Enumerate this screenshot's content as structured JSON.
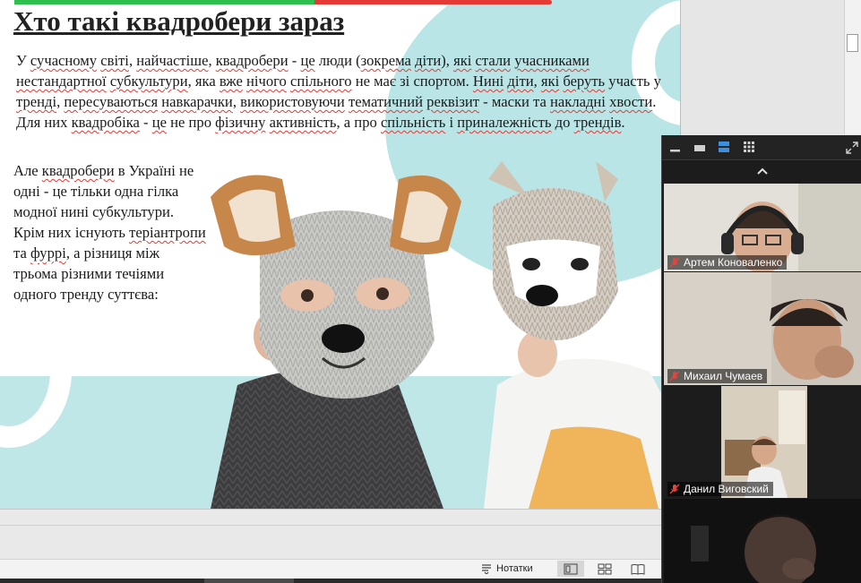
{
  "slide": {
    "title": "Хто такі квадробери зараз",
    "para1": [
      {
        "t": "У ",
        "s": false
      },
      {
        "t": "сучасному",
        "s": true
      },
      {
        "t": " ",
        "s": false
      },
      {
        "t": "світі",
        "s": true
      },
      {
        "t": ", ",
        "s": false
      },
      {
        "t": "найчастіше",
        "s": true
      },
      {
        "t": ", ",
        "s": false
      },
      {
        "t": "квадробери",
        "s": true
      },
      {
        "t": " - ",
        "s": false
      },
      {
        "t": "це",
        "s": true
      },
      {
        "t": " люди (",
        "s": false
      },
      {
        "t": "зокрема",
        "s": true
      },
      {
        "t": " ",
        "s": false
      },
      {
        "t": "діти",
        "s": true
      },
      {
        "t": "), ",
        "s": false
      },
      {
        "t": "які",
        "s": true
      },
      {
        "t": " ",
        "s": false
      },
      {
        "t": "стали",
        "s": true
      },
      {
        "t": " ",
        "s": false
      },
      {
        "t": "учасниками",
        "s": true
      },
      {
        "t": " ",
        "s": false
      },
      {
        "t": "нестандартної",
        "s": true
      },
      {
        "t": " ",
        "s": false
      },
      {
        "t": "субкультури",
        "s": true
      },
      {
        "t": ", яка ",
        "s": false
      },
      {
        "t": "вже",
        "s": true
      },
      {
        "t": " ",
        "s": false
      },
      {
        "t": "нічого",
        "s": true
      },
      {
        "t": " ",
        "s": false
      },
      {
        "t": "спільного",
        "s": true
      },
      {
        "t": " не має зі спортом. ",
        "s": false
      },
      {
        "t": "Нині",
        "s": true
      },
      {
        "t": " ",
        "s": false
      },
      {
        "t": "діти",
        "s": true
      },
      {
        "t": ", ",
        "s": false
      },
      {
        "t": "які",
        "s": true
      },
      {
        "t": " ",
        "s": false
      },
      {
        "t": "беруть",
        "s": true
      },
      {
        "t": " участь у ",
        "s": false
      },
      {
        "t": "тренді",
        "s": true
      },
      {
        "t": ", ",
        "s": false
      },
      {
        "t": "пересуваються",
        "s": true
      },
      {
        "t": " ",
        "s": false
      },
      {
        "t": "навкарачки",
        "s": true
      },
      {
        "t": ", ",
        "s": false
      },
      {
        "t": "використовуючи",
        "s": true
      },
      {
        "t": " ",
        "s": false
      },
      {
        "t": "тематичний",
        "s": true
      },
      {
        "t": " ",
        "s": false
      },
      {
        "t": "реквізит",
        "s": true
      },
      {
        "t": " - маски та ",
        "s": false
      },
      {
        "t": "накладні",
        "s": true
      },
      {
        "t": " ",
        "s": false
      },
      {
        "t": "хвости",
        "s": true
      },
      {
        "t": ". Для них ",
        "s": false
      },
      {
        "t": "квадробіка",
        "s": true
      },
      {
        "t": " - ",
        "s": false
      },
      {
        "t": "це",
        "s": true
      },
      {
        "t": " не про ",
        "s": false
      },
      {
        "t": "фізичну",
        "s": true
      },
      {
        "t": " ",
        "s": false
      },
      {
        "t": "активність",
        "s": true
      },
      {
        "t": ", а про ",
        "s": false
      },
      {
        "t": "спільність",
        "s": true
      },
      {
        "t": " і ",
        "s": false
      },
      {
        "t": "приналежність",
        "s": true
      },
      {
        "t": " до ",
        "s": false
      },
      {
        "t": "трендів",
        "s": true
      },
      {
        "t": ".",
        "s": false
      }
    ],
    "para2": [
      {
        "t": "Але ",
        "s": false
      },
      {
        "t": "квадробери",
        "s": true
      },
      {
        "t": " в Україні не одні - це тільки одна гілка модної нині субкультури. Крім них існують ",
        "s": false
      },
      {
        "t": "теріантропи",
        "s": true
      },
      {
        "t": " та ",
        "s": false
      },
      {
        "t": "фуррі",
        "s": true
      },
      {
        "t": ", а різниця між трьома різними течіями одного тренду суттєва:",
        "s": false
      }
    ]
  },
  "status_bar": {
    "notes_label": "Нотатки"
  },
  "zoom": {
    "participants": [
      {
        "name": "Артем Коноваленко"
      },
      {
        "name": "Михаил Чумаев"
      },
      {
        "name": "Данил Виговский"
      },
      {
        "name": ""
      }
    ]
  },
  "colors": {
    "accent_green": "#2fbf4f",
    "accent_red": "#e53935",
    "slide_teal": "#bfe7e8",
    "zoom_bg": "#1e1e1e"
  },
  "icons": [
    "minimize-icon",
    "thumbnail-view-icon",
    "speaker-view-icon",
    "gallery-view-icon",
    "expand-icon",
    "chevron-up-icon",
    "mic-muted-icon",
    "notes-icon",
    "normal-view-icon",
    "slide-sorter-icon",
    "reading-view-icon"
  ]
}
